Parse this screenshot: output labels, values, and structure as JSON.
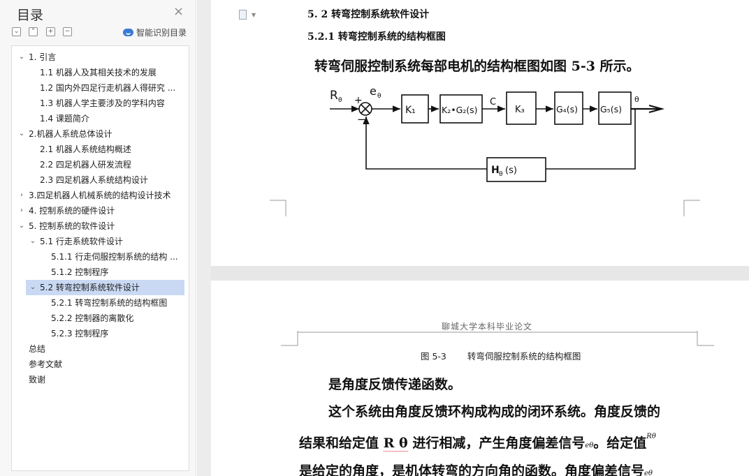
{
  "sidebar": {
    "title": "目录",
    "close": "×",
    "tools": [
      "⌄",
      "⌃",
      "+",
      "−"
    ],
    "smart_label": "智能识别目录",
    "items": [
      {
        "label": "1. 引言",
        "level": 0,
        "chev": "⌄"
      },
      {
        "label": "1.1 机器人及其相关技术的发展",
        "level": 1
      },
      {
        "label": "1.2 国内外四足行走机器人得研究 ...",
        "level": 1
      },
      {
        "label": "1.3 机器人学主要涉及的学科内容",
        "level": 1
      },
      {
        "label": "1.4  课题简介",
        "level": 1
      },
      {
        "label": "2.机器人系统总体设计",
        "level": 0,
        "chev": "⌄"
      },
      {
        "label": "2.1 机器人系统结构概述",
        "level": 1
      },
      {
        "label": "2.2  四足机器人研发流程",
        "level": 1
      },
      {
        "label": "2.3 四足机器人系统结构设计",
        "level": 1
      },
      {
        "label": "3.四足机器人机械系统的结构设计技术",
        "level": 0,
        "chev": "›"
      },
      {
        "label": "4.  控制系统的硬件设计",
        "level": 0,
        "chev": "›"
      },
      {
        "label": "5.  控制系统的软件设计",
        "level": 0,
        "chev": "⌄"
      },
      {
        "label": "5.1  行走系统软件设计",
        "level": 1,
        "chev": "⌄"
      },
      {
        "label": "5.1.1    行走伺服控制系统的结构 ...",
        "level": 2
      },
      {
        "label": "5.1.2 控制程序",
        "level": 2
      },
      {
        "label": "5.2 转弯控制系统软件设计",
        "level": 1,
        "chev": "⌄",
        "selected": true
      },
      {
        "label": "5.2.1 转弯控制系统的结构框图",
        "level": 2
      },
      {
        "label": "5.2.2  控制器的离散化",
        "level": 2
      },
      {
        "label": "5.2.3  控制程序",
        "level": 2
      },
      {
        "label": "总结",
        "level": 0
      },
      {
        "label": "参考文献",
        "level": 0
      },
      {
        "label": "致谢",
        "level": 0
      }
    ]
  },
  "page1": {
    "heading1": "5. 2 转弯控制系统软件设计",
    "heading2": "5.2.1 转弯控制系统的结构框图",
    "intro": "转弯伺服控制系统每部电机的结构框图如图 5-3 所示。",
    "diagram": {
      "input": "R",
      "input_sub": "θ",
      "plus": "+",
      "minus": "−",
      "error": "e",
      "error_sub": "θ",
      "signal_c": "C",
      "output": "θ",
      "blocks": [
        "K₁",
        "K₂•G₂(s)",
        "K₃",
        "G₄(s)",
        "G₅(s)"
      ],
      "feedback_block": "H",
      "feedback_sub": "θ",
      "feedback_tail": "(s)"
    }
  },
  "page2": {
    "header": "聊城大学本科毕业论文",
    "caption_num": "图 5-3",
    "caption_text": "转弯伺服控制系统的结构框图",
    "line1": "是角度反馈传递函数。",
    "line2": "这个系统由角度反馈环构成构成的闭环系统。角度反馈的",
    "line3a": "结果和给定值 ",
    "line3b": "R θ",
    "line3c": " 进行相减，产生角度偏差信号",
    "line3d": "eθ",
    "line3e": "。给定值",
    "line3f": "Rθ",
    "line4": "是给定的角度，是机体转弯的方向角的函数。角度偏差信号",
    "line4b": "eθ"
  }
}
